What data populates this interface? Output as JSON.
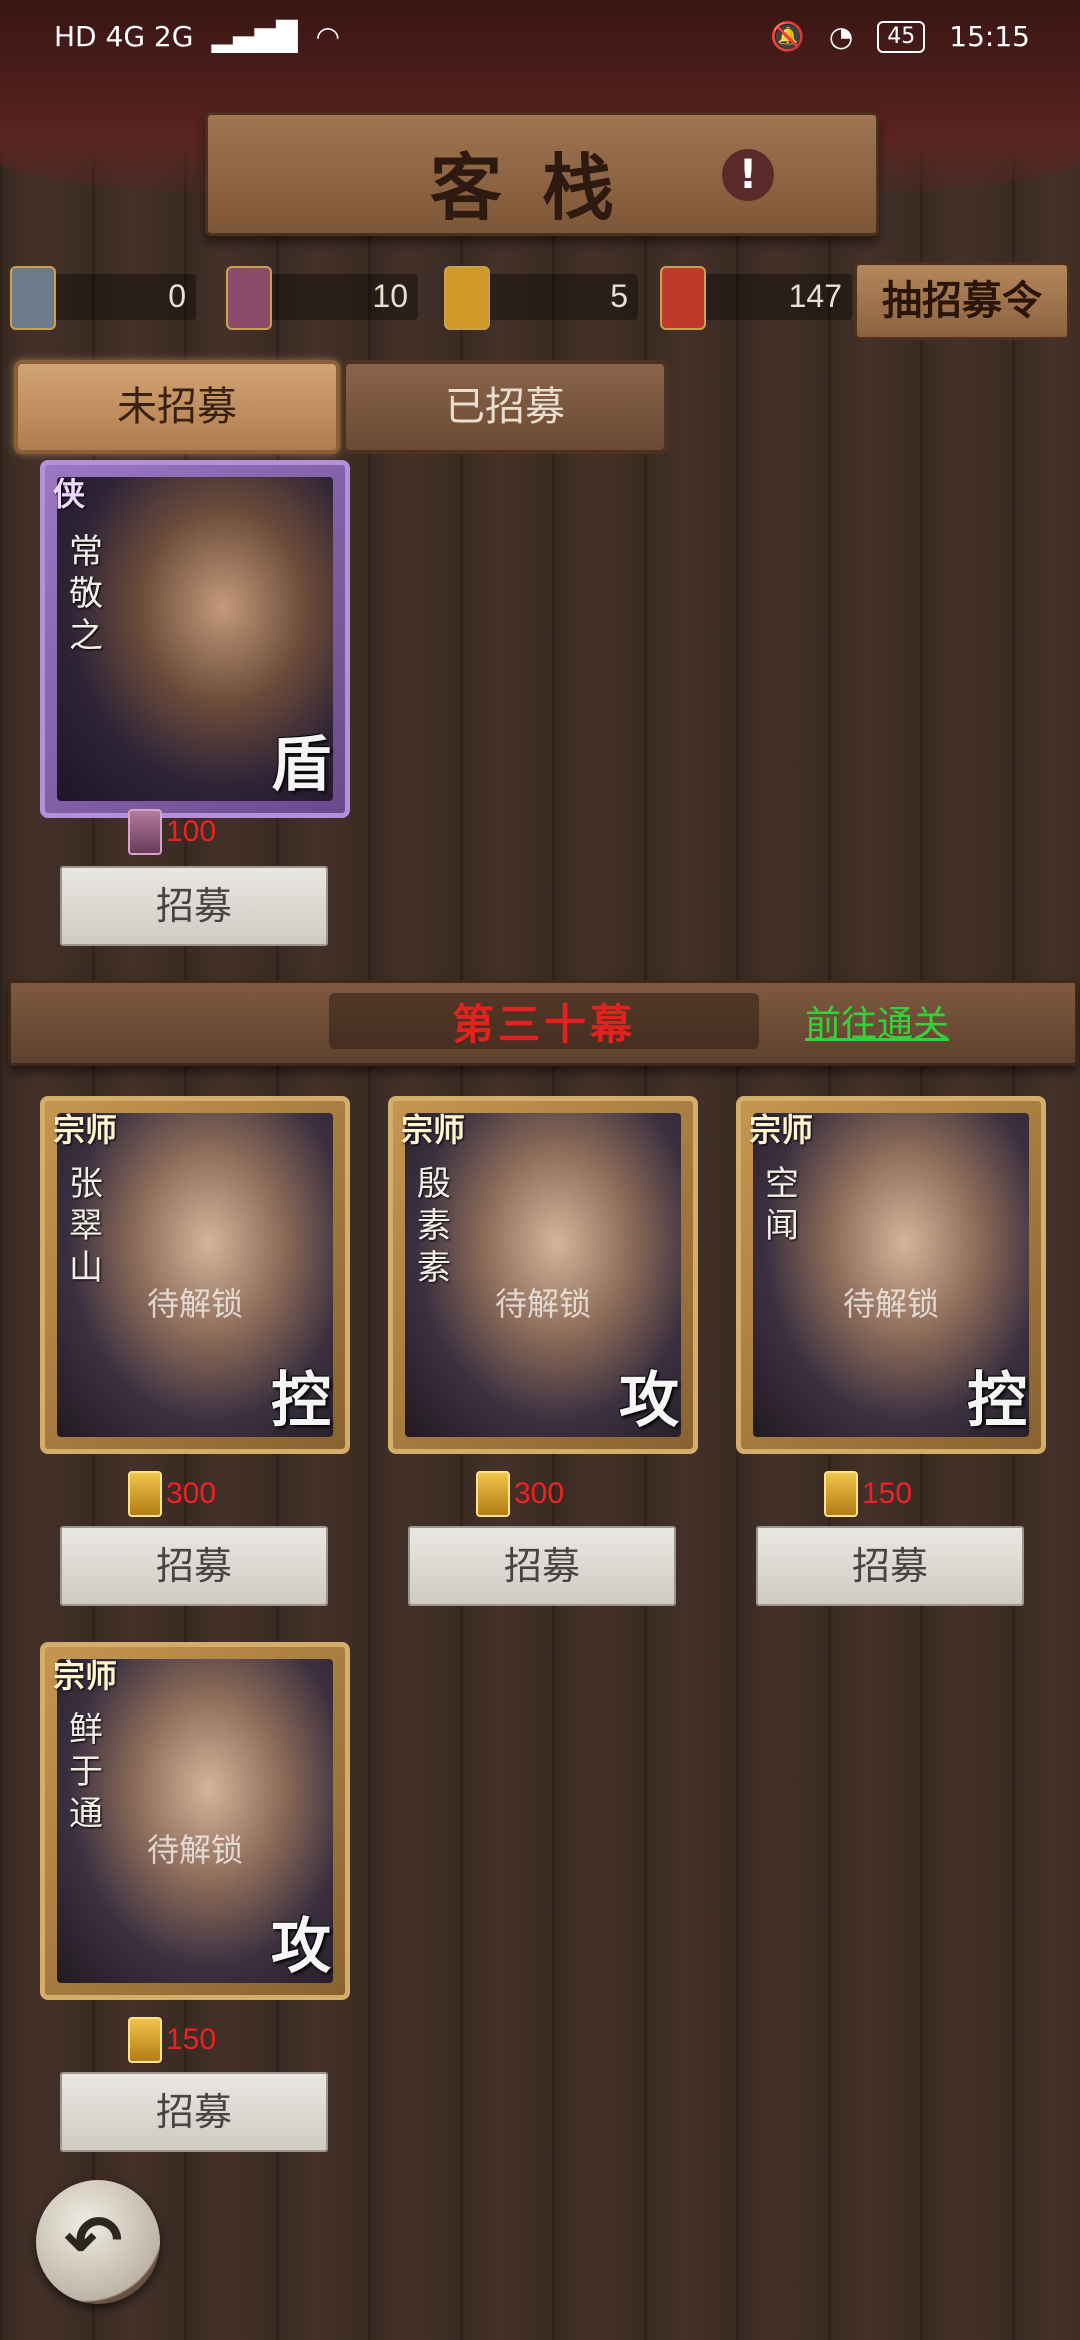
{
  "status_bar": {
    "left_text": "HD 4G 2G",
    "battery": "45",
    "time": "15:15"
  },
  "header": {
    "title": "客栈",
    "info_icon": "exclamation-icon"
  },
  "currencies": [
    {
      "icon": "gray-token-icon",
      "value": "0"
    },
    {
      "icon": "purple-token-icon",
      "value": "10"
    },
    {
      "icon": "gold-token-icon",
      "value": "5"
    },
    {
      "icon": "red-token-icon",
      "value": "147"
    }
  ],
  "draw_button": {
    "label": "抽招募令"
  },
  "tabs": [
    {
      "label": "未招募",
      "active": true
    },
    {
      "label": "已招募",
      "active": false
    }
  ],
  "unrecruited": [
    {
      "rank": "侠",
      "name": "常敬之",
      "role": "盾",
      "locked_text": "",
      "cost": "100",
      "cost_icon": "purple",
      "button": "招募"
    }
  ],
  "section": {
    "title": "第三十幕",
    "link": "前往通关"
  },
  "section_heroes": [
    {
      "rank": "宗师",
      "name": "张翠山",
      "role": "控",
      "locked_text": "待解锁",
      "cost": "300",
      "cost_icon": "gold",
      "button": "招募"
    },
    {
      "rank": "宗师",
      "name": "殷素素",
      "role": "攻",
      "locked_text": "待解锁",
      "cost": "300",
      "cost_icon": "gold",
      "button": "招募"
    },
    {
      "rank": "宗师",
      "name": "空闻",
      "role": "控",
      "locked_text": "待解锁",
      "cost": "150",
      "cost_icon": "gold",
      "button": "招募"
    },
    {
      "rank": "宗师",
      "name": "鲜于通",
      "role": "攻",
      "locked_text": "待解锁",
      "cost": "150",
      "cost_icon": "gold",
      "button": "招募"
    }
  ],
  "back_button": {
    "icon": "back-arrow-icon"
  }
}
